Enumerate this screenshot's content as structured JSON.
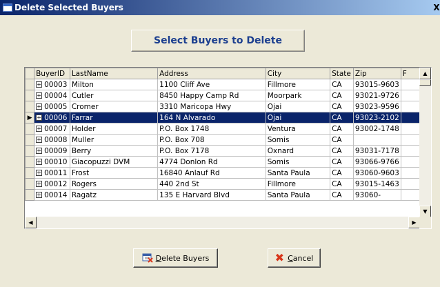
{
  "window": {
    "title": "Delete Selected Buyers",
    "close_glyph": "X"
  },
  "heading": "Select Buyers to Delete",
  "grid": {
    "columns": [
      "BuyerID",
      "LastName",
      "Address",
      "City",
      "State",
      "Zip",
      "F"
    ],
    "selected_row_index": 3,
    "rows": [
      {
        "id": "00003",
        "last": "Milton",
        "address": "1100 Cliff Ave",
        "city": "Fillmore",
        "state": "CA",
        "zip": "93015-9603"
      },
      {
        "id": "00004",
        "last": "Cutler",
        "address": "8450 Happy Camp Rd",
        "city": "Moorpark",
        "state": "CA",
        "zip": "93021-9726"
      },
      {
        "id": "00005",
        "last": "Cromer",
        "address": "3310 Maricopa Hwy",
        "city": "Ojai",
        "state": "CA",
        "zip": "93023-9596"
      },
      {
        "id": "00006",
        "last": "Farrar",
        "address": "164 N Alvarado",
        "city": "Ojai",
        "state": "CA",
        "zip": "93023-2102"
      },
      {
        "id": "00007",
        "last": "Holder",
        "address": "P.O. Box 1748",
        "city": "Ventura",
        "state": "CA",
        "zip": "93002-1748"
      },
      {
        "id": "00008",
        "last": "Muller",
        "address": "P.O. Box 708",
        "city": "Somis",
        "state": "CA",
        "zip": ""
      },
      {
        "id": "00009",
        "last": "Berry",
        "address": "P.O. Box 7178",
        "city": "Oxnard",
        "state": "CA",
        "zip": "93031-7178"
      },
      {
        "id": "00010",
        "last": "Giacopuzzi DVM",
        "address": "4774 Donlon Rd",
        "city": "Somis",
        "state": "CA",
        "zip": "93066-9766"
      },
      {
        "id": "00011",
        "last": "Frost",
        "address": "16840 Anlauf Rd",
        "city": "Santa Paula",
        "state": "CA",
        "zip": "93060-9603"
      },
      {
        "id": "00012",
        "last": "Rogers",
        "address": "440 2nd St",
        "city": "Fillmore",
        "state": "CA",
        "zip": "93015-1463"
      },
      {
        "id": "00014",
        "last": "Ragatz",
        "address": "135 E Harvard Blvd",
        "city": "Santa Paula",
        "state": "CA",
        "zip": "93060-"
      }
    ]
  },
  "buttons": {
    "delete": "Delete Buyers",
    "cancel": "Cancel"
  }
}
